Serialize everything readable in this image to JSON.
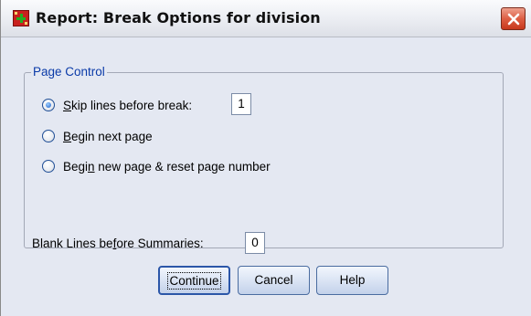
{
  "window": {
    "title": "Report: Break Options for division"
  },
  "page_control": {
    "legend": "Page Control",
    "options": [
      {
        "before": "",
        "mnemonic": "S",
        "after": "kip lines before break:",
        "selected": true
      },
      {
        "before": "",
        "mnemonic": "B",
        "after": "egin next page",
        "selected": false
      },
      {
        "before": "Begi",
        "mnemonic": "n",
        "after": " new page & reset page number",
        "selected": false
      }
    ],
    "skip_lines_value": "1"
  },
  "blank_lines": {
    "label_before": "Blank Lines be",
    "mnemonic": "f",
    "label_after": "ore Summaries:",
    "value": "0"
  },
  "buttons": {
    "continue": "Continue",
    "cancel": "Cancel",
    "help": "Help"
  },
  "icons": {
    "app": "spss-dialog-icon",
    "close": "close-icon"
  },
  "colors": {
    "dialog_background": "#e4e8f2",
    "group_legend": "#0a3aa8",
    "close_button": "#d14c31"
  }
}
